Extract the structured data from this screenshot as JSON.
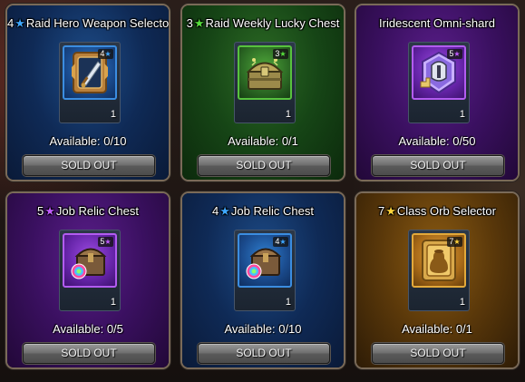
{
  "colors": {
    "star_blue": "#3ea7ff",
    "star_green": "#57e03c",
    "star_purple": "#c15bff",
    "star_yellow": "#ffd43a"
  },
  "shop": {
    "items": [
      {
        "title_prefix": "4",
        "title_star_color": "blue",
        "title": "Raid Hero Weapon Selector",
        "grade": "4",
        "icon": "sword-selector-icon",
        "quantity": "1",
        "available": "Available: 0/10",
        "button": "SOLD OUT"
      },
      {
        "title_prefix": "3",
        "title_star_color": "green",
        "title": "Raid Weekly Lucky Chest",
        "grade": "3",
        "icon": "lucky-chest-icon",
        "quantity": "1",
        "available": "Available: 0/1",
        "button": "SOLD OUT"
      },
      {
        "title_prefix": "",
        "title_star_color": "",
        "title": "Iridescent Omni-shard",
        "grade": "5",
        "icon": "omni-shard-icon",
        "quantity": "1",
        "available": "Available: 0/50",
        "button": "SOLD OUT"
      },
      {
        "title_prefix": "5",
        "title_star_color": "purple",
        "title": "Job Relic Chest",
        "grade": "5",
        "icon": "relic-chest-icon",
        "quantity": "1",
        "available": "Available: 0/5",
        "button": "SOLD OUT"
      },
      {
        "title_prefix": "4",
        "title_star_color": "blue",
        "title": "Job Relic Chest",
        "grade": "4",
        "icon": "relic-chest-icon",
        "quantity": "1",
        "available": "Available: 0/10",
        "button": "SOLD OUT"
      },
      {
        "title_prefix": "7",
        "title_star_color": "yellow",
        "title": "Class Orb Selector",
        "grade": "7",
        "icon": "orb-selector-icon",
        "quantity": "1",
        "available": "Available: 0/1",
        "button": "SOLD OUT"
      }
    ]
  }
}
